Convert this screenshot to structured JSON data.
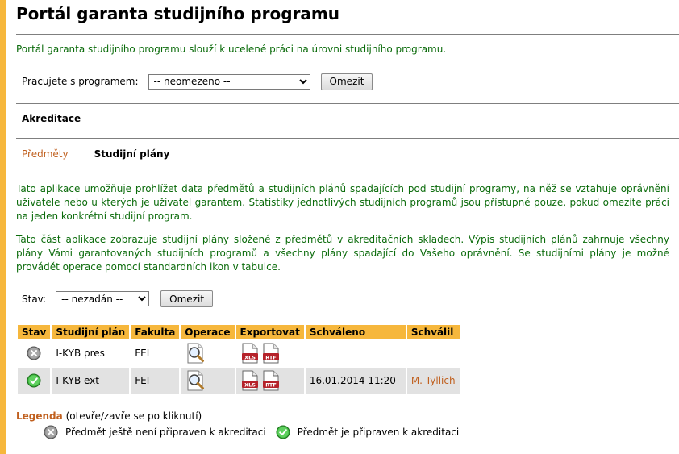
{
  "page": {
    "title": "Portál garanta studijního programu",
    "intro": "Portál garanta studijního programu slouží k ucelené práci na úrovni studijního programu."
  },
  "program": {
    "label": "Pracujete s programem:",
    "selected": "-- neomezeno --",
    "button": "Omezit"
  },
  "section": {
    "title": "Akreditace"
  },
  "tabs": {
    "items": [
      "Předměty",
      "Studijní plány"
    ],
    "active": "Studijní plány"
  },
  "paragraphs": {
    "p1": "Tato aplikace umožňuje prohlížet data předmětů a studijních plánů spadajících pod studijní programy, na něž se vztahuje oprávnění uživatele nebo u kterých je uživatel garantem. Statistiky jednotlivých studijních programů jsou přístupné pouze, pokud omezíte práci na jeden konkrétní studijní program.",
    "p2": "Tato část aplikace zobrazuje studijní plány složené z předmětů v akreditačních skladech. Výpis studijních plánů zahrnuje všechny plány Vámi garantovaných studijních programů a všechny plány spadající do Vašeho oprávnění. Se studijními plány je možné provádět operace pomocí standardních ikon v tabulce."
  },
  "filter": {
    "label": "Stav:",
    "selected": "-- nezadán --",
    "button": "Omezit"
  },
  "table": {
    "headers": [
      "Stav",
      "Studijní plán",
      "Fakulta",
      "Operace",
      "Exportovat",
      "Schváleno",
      "Schválil"
    ],
    "rows": [
      {
        "status": "not-ready",
        "plan": "I-KYB pres",
        "faculty": "FEI",
        "exports": [
          "XLS",
          "RTF"
        ],
        "approved": "",
        "approver": ""
      },
      {
        "status": "ready",
        "plan": "I-KYB ext",
        "faculty": "FEI",
        "exports": [
          "XLS",
          "RTF"
        ],
        "approved": "16.01.2014 11:20",
        "approver": "M. Tyllich"
      }
    ]
  },
  "legend": {
    "title": "Legenda",
    "hint": "(otevře/zavře se po kliknutí)",
    "items": [
      {
        "icon": "grey-cross-icon",
        "text": "Předmět ještě není připraven k akreditaci"
      },
      {
        "icon": "green-check-icon",
        "text": "Předmět je připraven k akreditaci"
      }
    ]
  },
  "colors": {
    "accent": "#f6b73c",
    "link": "#c0601f",
    "text_green": "#0b6b0b",
    "row_alt": "#e2e2e2"
  }
}
